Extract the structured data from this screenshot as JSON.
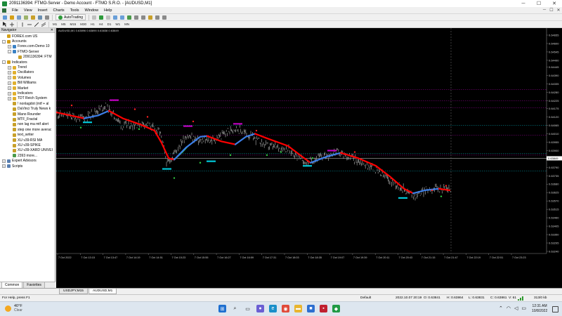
{
  "window": {
    "title": "2091136394: FTMO-Server - Demo Account - FTMO S.R.O. - [AUDUSD,M1]",
    "minimize": "─",
    "maximize": "☐",
    "close": "✕"
  },
  "menu": [
    "File",
    "View",
    "Insert",
    "Charts",
    "Tools",
    "Window",
    "Help"
  ],
  "toolbar": {
    "autotrading_label": "AutoTrading",
    "timeframes": [
      "M1",
      "M5",
      "M15",
      "M30",
      "H1",
      "H4",
      "D1",
      "W1",
      "MN"
    ]
  },
  "navigator": {
    "title": "Navigator",
    "close": "✕",
    "tree": [
      {
        "label": "FOREX.com US",
        "level": 0,
        "expander": "",
        "icon": "folder-icon",
        "color": "#d4a017"
      },
      {
        "label": "Accounts",
        "level": 0,
        "expander": "-",
        "icon": "accounts-icon",
        "color": "#d4a017"
      },
      {
        "label": "Forex.com-Demo 10",
        "level": 1,
        "expander": "+",
        "icon": "server-icon",
        "color": "#3b82c4"
      },
      {
        "label": "FTMO-Server",
        "level": 1,
        "expander": "-",
        "icon": "server-icon",
        "color": "#3b82c4"
      },
      {
        "label": "2091136394: FTM",
        "level": 2,
        "expander": "",
        "icon": "account-icon",
        "color": "#c8a02a"
      },
      {
        "label": "Indicators",
        "level": 0,
        "expander": "-",
        "icon": "indicators-icon",
        "color": "#d4a017"
      },
      {
        "label": "Trend",
        "level": 1,
        "expander": "+",
        "icon": "folder-icon",
        "color": "#e0b030"
      },
      {
        "label": "Oscillators",
        "level": 1,
        "expander": "+",
        "icon": "folder-icon",
        "color": "#e0b030"
      },
      {
        "label": "Volumes",
        "level": 1,
        "expander": "+",
        "icon": "folder-icon",
        "color": "#e0b030"
      },
      {
        "label": "Bill Williams",
        "level": 1,
        "expander": "+",
        "icon": "folder-icon",
        "color": "#e0b030"
      },
      {
        "label": "Market",
        "level": 1,
        "expander": "+",
        "icon": "folder-icon",
        "color": "#e0b030"
      },
      {
        "label": "Indicators",
        "level": 1,
        "expander": "+",
        "icon": "folder-icon",
        "color": "#e0b030"
      },
      {
        "label": "TDT Reich System",
        "level": 1,
        "expander": "+",
        "icon": "folder-icon",
        "color": "#e0b030"
      },
      {
        "label": "! nonlagdot (mtf + al",
        "level": 1,
        "expander": "",
        "icon": "indicator-icon",
        "color": "#c8a02a"
      },
      {
        "label": "DaVinci Truly News k",
        "level": 1,
        "expander": "",
        "icon": "indicator-icon",
        "color": "#c8a02a"
      },
      {
        "label": "Mano Rounder",
        "level": 1,
        "expander": "",
        "icon": "indicator-icon",
        "color": "#c8a02a"
      },
      {
        "label": "MTF_Fractal",
        "level": 1,
        "expander": "",
        "icon": "indicator-icon",
        "color": "#c8a02a"
      },
      {
        "label": "non lag ma mtf alert",
        "level": 1,
        "expander": "",
        "icon": "indicator-icon",
        "color": "#c8a02a"
      },
      {
        "label": "step one more averac",
        "level": 1,
        "expander": "",
        "icon": "indicator-icon",
        "color": "#c8a02a"
      },
      {
        "label": "text_writer",
        "level": 1,
        "expander": "",
        "icon": "indicator-icon",
        "color": "#c8a02a"
      },
      {
        "label": "XU v39-RSI MA",
        "level": 1,
        "expander": "",
        "icon": "indicator-icon",
        "color": "#c8a02a"
      },
      {
        "label": "XU v39-SPIKE",
        "level": 1,
        "expander": "",
        "icon": "indicator-icon",
        "color": "#c8a02a"
      },
      {
        "label": "XU v39-XARD UNIVEI",
        "level": 1,
        "expander": "",
        "icon": "indicator-icon",
        "color": "#c8a02a"
      },
      {
        "label": "2393 more...",
        "level": 1,
        "expander": "",
        "icon": "more-icon",
        "color": "#4a9a4a"
      },
      {
        "label": "Expert Advisors",
        "level": 0,
        "expander": "+",
        "icon": "experts-icon",
        "color": "#5a7fb0"
      },
      {
        "label": "Scripts",
        "level": 0,
        "expander": "+",
        "icon": "scripts-icon",
        "color": "#5a7fb0"
      }
    ],
    "tabs": [
      "Common",
      "Favorites"
    ]
  },
  "chart": {
    "symbol_label": "AUDUSD,M1 0.63896 0.63890 0.63838 0.63849",
    "bid_price": "0.63849",
    "price_labels": [
      "0.64655",
      "0.64600",
      "0.64545",
      "0.64490",
      "0.64445",
      "0.64390",
      "0.64335",
      "0.64280",
      "0.64225",
      "0.64175",
      "0.64120",
      "0.64065",
      "0.64010",
      "0.63955",
      "0.63900",
      "0.63845",
      "0.63790",
      "0.63735",
      "0.63680",
      "0.63625",
      "0.63570",
      "0.63515",
      "0.63460",
      "0.63405",
      "0.63350",
      "0.63295",
      "0.63240"
    ],
    "time_labels": [
      "7 Oct 2022",
      "7 Oct 13:15",
      "7 Oct 13:47",
      "7 Oct 14:19",
      "7 Oct 14:51",
      "7 Oct 15:23",
      "7 Oct 15:55",
      "7 Oct 16:27",
      "7 Oct 16:59",
      "7 Oct 17:31",
      "7 Oct 18:03",
      "7 Oct 18:35",
      "7 Oct 19:07",
      "7 Oct 19:39",
      "7 Oct 20:11",
      "7 Oct 20:43",
      "7 Oct 21:15",
      "7 Oct 21:47",
      "7 Oct 22:19",
      "7 Oct 22:51",
      "7 Oct 23:23"
    ],
    "colors": {
      "background": "#000000",
      "price_bars": "#a0a0a0",
      "trend_red": "#ff0000",
      "trend_blue": "#3c7fe8",
      "trend_green": "#2ecc40",
      "level_magenta": "#c000c0",
      "level_cyan": "#00c8d8",
      "grid": "#444444"
    }
  },
  "chart_tabs": [
    "USDJPY,M15",
    "AUDUSD,M1"
  ],
  "status": {
    "help": "For Help, press F1",
    "profile": "Default",
    "time": "2022.10.07 20:19",
    "open": "O: 0.63841",
    "high": "H: 0.63864",
    "low": "L: 0.63831",
    "close": "C: 0.63861",
    "volume": "V: 61",
    "traffic": "313/0 kb"
  },
  "taskbar": {
    "temperature": "40°F",
    "condition": "Clear",
    "clock_time": "12:31 AM",
    "clock_date": "10/8/2022",
    "apps": [
      "windows-start-icon",
      "search-icon",
      "task-view-icon",
      "chat-icon",
      "edge-icon",
      "chrome-icon",
      "file-explorer-icon",
      "store-icon",
      "app-icon",
      "metatrader-icon"
    ]
  }
}
